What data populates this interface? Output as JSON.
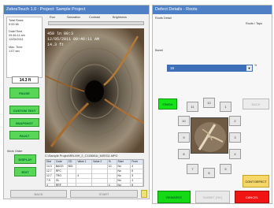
{
  "left_window": {
    "title": "ZebraTouch 1.0 : Project: Sample Project",
    "header_labels": [
      "Run",
      "Saturation",
      "Contrast",
      "Brightness"
    ],
    "info": {
      "total_rows_label": "Total Rows",
      "total_rows_value": "0:00:58",
      "date_time_label": "Date/Time",
      "date_time_value": "09:46:11 am",
      "date_value": "12/05/2011",
      "max_time_label": "Max. Time",
      "max_time_value": "1:07 sec"
    },
    "distance": "14.3 ft",
    "buttons": {
      "pause": "PAUSE",
      "custom_text": "CUSTOM TEXT",
      "snapshot": "SNAPSHOT",
      "fault": "FAULT",
      "display": "DISPLAY",
      "edit": "EDIT",
      "back": "BACK",
      "start": "START"
    },
    "work_order_label": "Work Order",
    "video_overlay": {
      "line1": "450 ln 00:3",
      "line2": "12/05/2011 09:46:11 AM",
      "line3": "14.3 ft"
    },
    "file_path": "C:\\Sample Project\\RN-MH_2_C11566\\U_MISS11.MPG",
    "table": {
      "columns": [
        "Dist",
        "Code",
        "CD",
        "Value 1",
        "Value 2",
        "%",
        "Start",
        "From"
      ],
      "rows": [
        [
          "14.3",
          "BAGG",
          "BGI",
          "",
          "",
          "10",
          "No",
          "4"
        ],
        [
          "12.7",
          "RFC",
          "",
          "",
          "",
          "",
          "No",
          "5"
        ],
        [
          "12.7",
          "TRG",
          "",
          "4",
          "",
          "",
          "No",
          "3"
        ],
        [
          "7.9",
          "GL",
          "",
          "",
          "",
          "",
          "No",
          "4"
        ],
        [
          "4",
          "RRF",
          "",
          "",
          "",
          "4",
          "No",
          "8"
        ],
        [
          "0",
          "AMH",
          "",
          "",
          "",
          "",
          "No",
          "1"
        ]
      ]
    }
  },
  "right_window": {
    "title": "Defect Details - Roots",
    "subtitle": "Roots Detail",
    "category": "Roots / Taps",
    "barrel_label": "Barrel",
    "dropdown_value": "18",
    "dropdown_suffix": "%",
    "clock_positions": [
      "12",
      "1",
      "2",
      "3",
      "4",
      "5",
      "6",
      "7",
      "8",
      "9",
      "10",
      "11"
    ],
    "buttons": {
      "finish": "FINISH",
      "back": "BACK",
      "cont_defect": "CONT DEFECT",
      "remarks": "REMARKS",
      "submit": "SUBMIT (OK)",
      "cancel": "CANCEL"
    }
  }
}
